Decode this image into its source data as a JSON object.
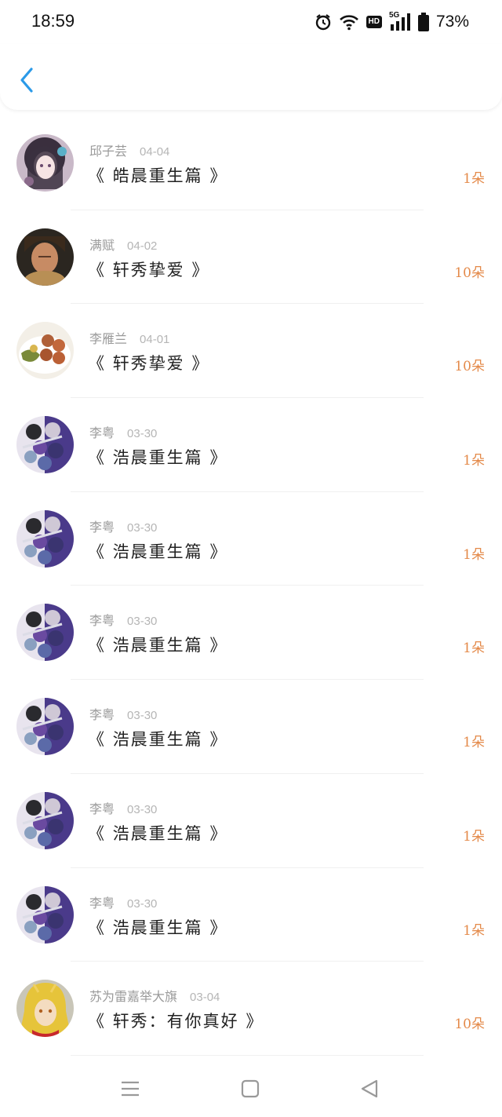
{
  "status_bar": {
    "time": "18:59",
    "battery_percent": "73%",
    "network_label": "5G",
    "hd_label": "HD",
    "icons": [
      "alarm-icon",
      "wifi-icon",
      "hd-icon",
      "signal-icon",
      "battery-icon"
    ]
  },
  "header": {
    "back_icon": "chevron-left-icon",
    "accent_color": "#2b9ae8"
  },
  "list": {
    "count_color": "#e48a4a",
    "items": [
      {
        "name": "邱子芸",
        "date": "04-04",
        "title": "《 皓晨重生篇 》",
        "count": "1朵",
        "avatar": "anime-girl"
      },
      {
        "name": "满赋",
        "date": "04-02",
        "title": "《 轩秀挚爱 》",
        "count": "10朵",
        "avatar": "photo-portrait"
      },
      {
        "name": "李雁兰",
        "date": "04-01",
        "title": "《 轩秀挚爱 》",
        "count": "10朵",
        "avatar": "food-plate"
      },
      {
        "name": "李粤",
        "date": "03-30",
        "title": "《 浩晨重生篇 》",
        "count": "1朵",
        "avatar": "anime-group"
      },
      {
        "name": "李粤",
        "date": "03-30",
        "title": "《 浩晨重生篇 》",
        "count": "1朵",
        "avatar": "anime-group"
      },
      {
        "name": "李粤",
        "date": "03-30",
        "title": "《 浩晨重生篇 》",
        "count": "1朵",
        "avatar": "anime-group"
      },
      {
        "name": "李粤",
        "date": "03-30",
        "title": "《 浩晨重生篇 》",
        "count": "1朵",
        "avatar": "anime-group"
      },
      {
        "name": "李粤",
        "date": "03-30",
        "title": "《 浩晨重生篇 》",
        "count": "1朵",
        "avatar": "anime-group"
      },
      {
        "name": "李粤",
        "date": "03-30",
        "title": "《 浩晨重生篇 》",
        "count": "1朵",
        "avatar": "anime-group"
      },
      {
        "name": "苏为雷嘉举大旗",
        "date": "03-04",
        "title": "《 轩秀：有你真好 》",
        "count": "10朵",
        "avatar": "anime-blonde"
      }
    ]
  },
  "nav_bar": {
    "icons": [
      "menu-icon",
      "home-icon",
      "back-triangle-icon"
    ]
  }
}
